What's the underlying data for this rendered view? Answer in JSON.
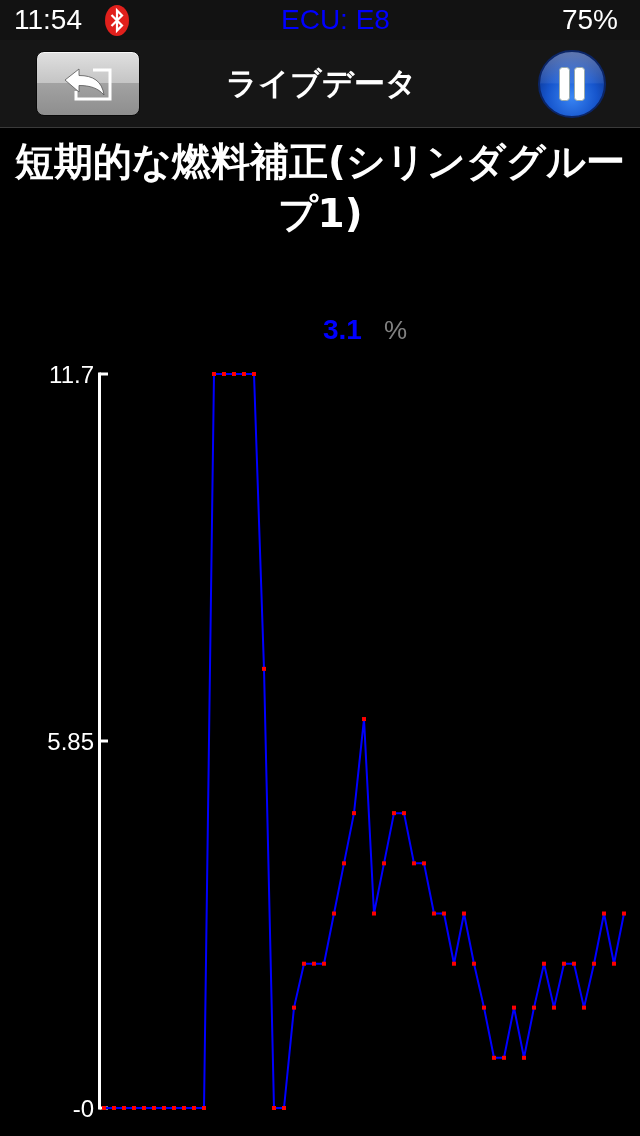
{
  "status_bar": {
    "time": "11:54",
    "ecu": "ECU: E8",
    "battery": "75%"
  },
  "nav_bar": {
    "title": "ライブデータ"
  },
  "parameter": {
    "title": "短期的な燃料補正(シリンダグループ1)",
    "value": "3.1",
    "unit": "%",
    "chart_data": {
      "type": "line",
      "categories": [
        null,
        null,
        null,
        null,
        null,
        null,
        null,
        null,
        null,
        null,
        null,
        null,
        null,
        null,
        null,
        null,
        null,
        null,
        null,
        null,
        null,
        null,
        null,
        null,
        null,
        null,
        null,
        null,
        null,
        null,
        null,
        null,
        null,
        null,
        null,
        null,
        null,
        null,
        null,
        null,
        null,
        null,
        null,
        null,
        null,
        null,
        null,
        null,
        null,
        null,
        null,
        null,
        null
      ],
      "series": [
        {
          "color": "#0000ff",
          "marker": "square",
          "values": [
            0,
            0,
            0,
            0,
            0,
            0,
            0,
            0,
            0,
            0,
            0,
            11.7,
            11.7,
            11.7,
            11.7,
            11.7,
            7.0,
            0,
            0,
            1.6,
            2.3,
            2.3,
            2.3,
            3.1,
            3.9,
            4.7,
            6.2,
            3.1,
            3.9,
            4.7,
            4.7,
            3.9,
            3.9,
            3.1,
            3.1,
            2.3,
            3.1,
            2.3,
            1.6,
            0.8,
            0.8,
            1.6,
            0.8,
            1.6,
            2.3,
            1.6,
            2.3,
            2.3,
            1.6,
            2.3,
            3.1,
            2.3,
            3.1
          ]
        }
      ],
      "ylim": [
        0,
        11.7
      ],
      "yticks": [
        {
          "value": 0,
          "label": "-0"
        },
        {
          "value": 5.85,
          "label": "5.85"
        },
        {
          "value": 11.7,
          "label": "11.7"
        }
      ]
    }
  }
}
